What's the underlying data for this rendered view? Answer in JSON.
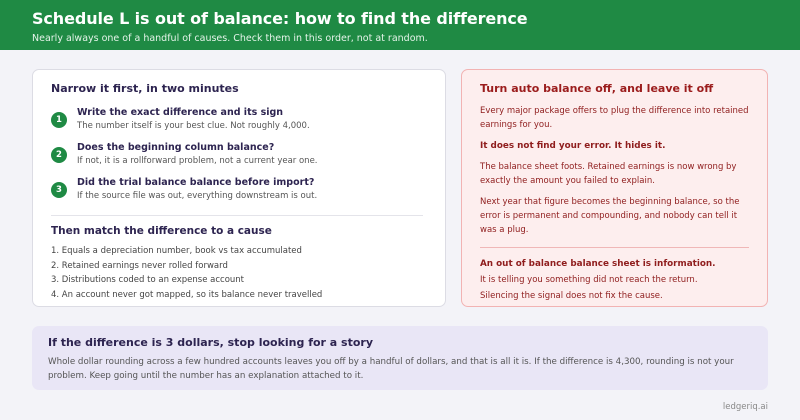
{
  "header": {
    "title": "Schedule L is out of balance: how to find the difference",
    "subtitle": "Nearly always one of a handful of causes. Check them in this order, not at random."
  },
  "left_card": {
    "title": "Narrow it first, in two minutes",
    "steps": [
      {
        "num": "1",
        "title": "Write the exact difference and its sign",
        "desc": "The number itself is your best clue. Not roughly 4,000."
      },
      {
        "num": "2",
        "title": "Does the beginning column balance?",
        "desc": "If not, it is a rollforward problem, not a current year one."
      },
      {
        "num": "3",
        "title": "Did the trial balance balance before import?",
        "desc": "If the source file was out, everything downstream is out."
      }
    ],
    "causes_title": "Then match the difference to a cause",
    "causes": [
      "1. Equals a depreciation number, book vs tax accumulated",
      "2. Retained earnings never rolled forward",
      "3. Distributions coded to an expense account",
      "4. An account never got mapped, so its balance never travelled"
    ]
  },
  "right_card": {
    "title": "Turn auto balance off, and leave it off",
    "p1": "Every major package offers to plug the difference into retained earnings for you.",
    "strong1": "It does not find your error. It hides it.",
    "p2": "The balance sheet foots. Retained earnings is now wrong by exactly the amount you failed to explain.",
    "p3": "Next year that figure becomes the beginning balance, so the error is permanent and compounding, and nobody can tell it was a plug.",
    "strong2": "An out of balance balance sheet is information.",
    "p4": "It is telling you something did not reach the return.",
    "p5": "Silencing the signal does not fix the cause."
  },
  "banner": {
    "title": "If the difference is 3 dollars, stop looking for a story",
    "text": "Whole dollar rounding across a few hundred accounts leaves you off by a handful of dollars, and that is all it is. If the difference is 4,300, rounding is not your problem. Keep going until the number has an explanation attached to it."
  },
  "brand": "ledgeriq.ai",
  "colors": {
    "header_green": "#1f8a44",
    "warning_red": "#9b1c1c",
    "banner_lavender": "#e9e6f6"
  }
}
